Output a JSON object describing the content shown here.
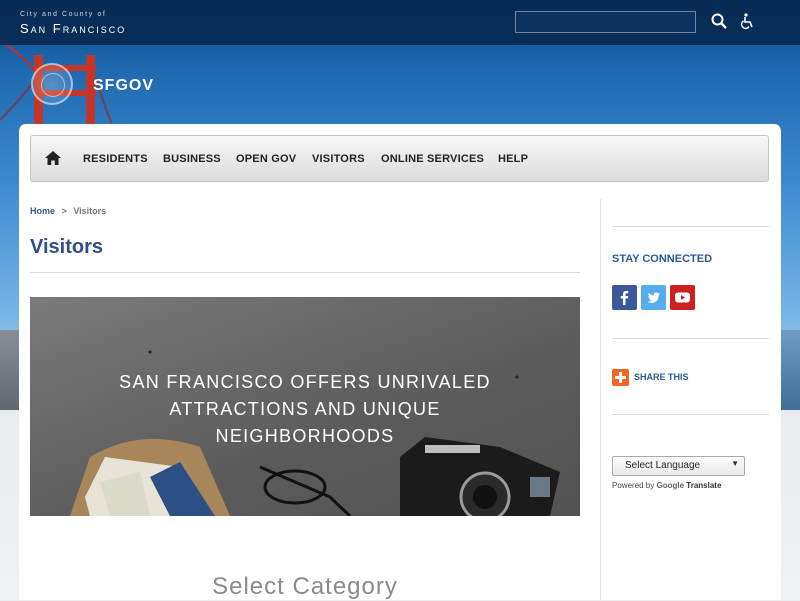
{
  "header": {
    "brand_small": "City and County of",
    "brand_big": "San Francisco",
    "search_placeholder": "",
    "site_name": "SFGOV"
  },
  "nav": {
    "items": [
      "RESIDENTS",
      "BUSINESS",
      "OPEN GOV",
      "VISITORS",
      "ONLINE SERVICES",
      "HELP"
    ]
  },
  "breadcrumb": {
    "home": "Home",
    "separator": ">",
    "current": "Visitors"
  },
  "main": {
    "title": "Visitors",
    "hero_text": "SAN FRANCISCO OFFERS UNRIVALED ATTRACTIONS AND UNIQUE NEIGHBORHOODS",
    "select_category": "Select Category"
  },
  "sidebar": {
    "stay_connected": "STAY CONNECTED",
    "social": [
      {
        "name": "facebook-icon",
        "color": "#3b5998"
      },
      {
        "name": "twitter-icon",
        "color": "#55acee"
      },
      {
        "name": "youtube-icon",
        "color": "#cd201f"
      }
    ],
    "share_label": "SHARE THIS",
    "language_select": "Select Language",
    "powered_by": "Powered by",
    "google": "Google",
    "translate": "Translate"
  },
  "colors": {
    "link_blue": "#2a5a9a",
    "title_blue": "#2d4f86",
    "share_orange": "#f26522"
  }
}
